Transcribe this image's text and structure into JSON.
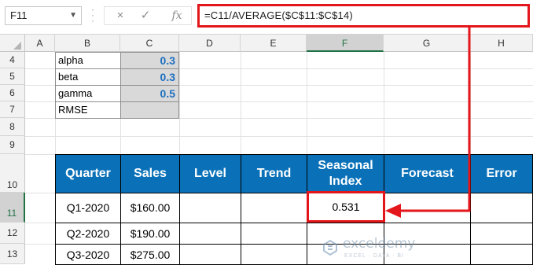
{
  "formula_bar": {
    "name_box": "F11",
    "cancel_icon": "×",
    "enter_icon": "✓",
    "fx_label": "fx",
    "formula": "=C11/AVERAGE($C$11:$C$14)"
  },
  "columns": [
    "A",
    "B",
    "C",
    "D",
    "E",
    "F",
    "G",
    "H"
  ],
  "rows": [
    "4",
    "5",
    "6",
    "7",
    "8",
    "9",
    "10",
    "11",
    "12",
    "13"
  ],
  "params": [
    {
      "label": "alpha",
      "value": "0.3"
    },
    {
      "label": "beta",
      "value": "0.3"
    },
    {
      "label": "gamma",
      "value": "0.5"
    },
    {
      "label": "RMSE",
      "value": ""
    }
  ],
  "table": {
    "headers": [
      "Quarter",
      "Sales",
      "Level",
      "Trend",
      "Seasonal Index",
      "Forecast",
      "Error"
    ],
    "rows": [
      [
        "Q1-2020",
        "$160.00",
        "",
        "",
        "0.531",
        "",
        ""
      ],
      [
        "Q2-2020",
        "$190.00",
        "",
        "",
        "",
        "",
        ""
      ],
      [
        "Q3-2020",
        "$275.00",
        "",
        "",
        "",
        "",
        ""
      ]
    ]
  },
  "watermark": {
    "name": "exceldemy",
    "tagline": "EXCEL · DATA · BI"
  },
  "colors": {
    "accent_red": "#e3161b",
    "header_blue": "#0a71b8",
    "value_blue": "#1e6fc0"
  }
}
